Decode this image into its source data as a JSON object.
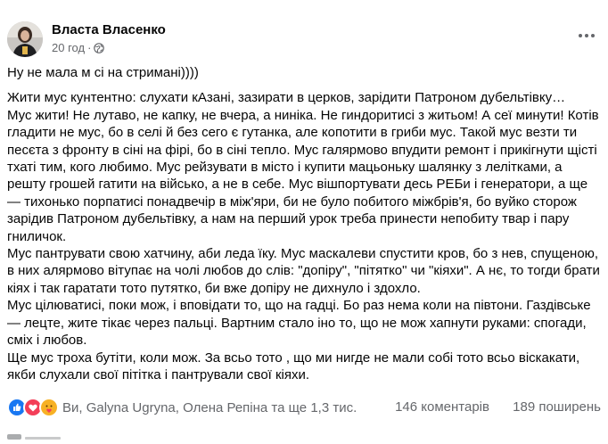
{
  "post": {
    "author": "Власта Власенко",
    "time": "20 год",
    "meta_separator": "·",
    "privacy_icon": "globe-icon",
    "more_icon": "more-horizontal-icon",
    "paragraphs": [
      "Ну не мала м сі на стримані))))",
      "Жити мус кунтентно: слухати кАзані, зазирати в церков, зарідити Патроном дубельтівку…",
      "Мус жити! Не лутаво, не капку, не вчера, а ниніка. Не гиндоритисі з житьом! А сеї минути! Котів гладити не мус, бо в селі й без сего є гутанка, але копотити в гриби мус. Такой мус везти ти песєта з фронту в сіні на фірі, бо в сіні тепло. Мус галярмово впудити ремонт і прикігнути щісті тхаті тим, кого любимо. Мус рейзувати в місто і купити мацьоньку шалянку з лелітками, а решту грошей гатити  на військо, а не в себе. Мус  вішпортувати десь РЕБи і генератори, а ще — тихонько порпатисі понадвечір в між'яри, би не було побитого міжбрів'я,  бо вуйко сторож зарідив Патроном дубельтівку, а нам  на перший урок  треба принести непобиту твар і пару гниличок.",
      "Мус пантрувати свою хатчину, аби леда їку. Мус маскалеви спустити кров, бо з нев, спущеною, в них  алярмово вітупає на чолі  любов до слів: \"допіру\", \"пітятко\" чи \"кіяхи\". А нє, то тогди брати кіях і так гаратати тото путятко, би вже допіру не дихнуло і здохло.",
      "Мус цілюватисі, поки мож, і вповідати то, що на гадці. Бо раз нема коли на півтони. Газдівське — лецте, жите тікає через пальці. Вартним стало іно то, що не мож хапнути руками: спогади, сміх і любов.",
      "Ще мус троха бутіти, коли мож. За всьо тото , що ми нигде не мали собі тото  всьо віскакати, якби слухали свої пітітка і пантрували свої кіяхи."
    ]
  },
  "reactions": {
    "icons": [
      "like-icon",
      "love-icon",
      "care-icon"
    ],
    "colors": {
      "like": "#1877f2",
      "love": "#f33e58",
      "care": "#f7b125"
    },
    "reactors_text": "Ви, Galyna Ugryna, Олена Репіна та ще 1,3 тис.",
    "comments_text": "146 коментарів",
    "shares_text": "189 поширень"
  }
}
